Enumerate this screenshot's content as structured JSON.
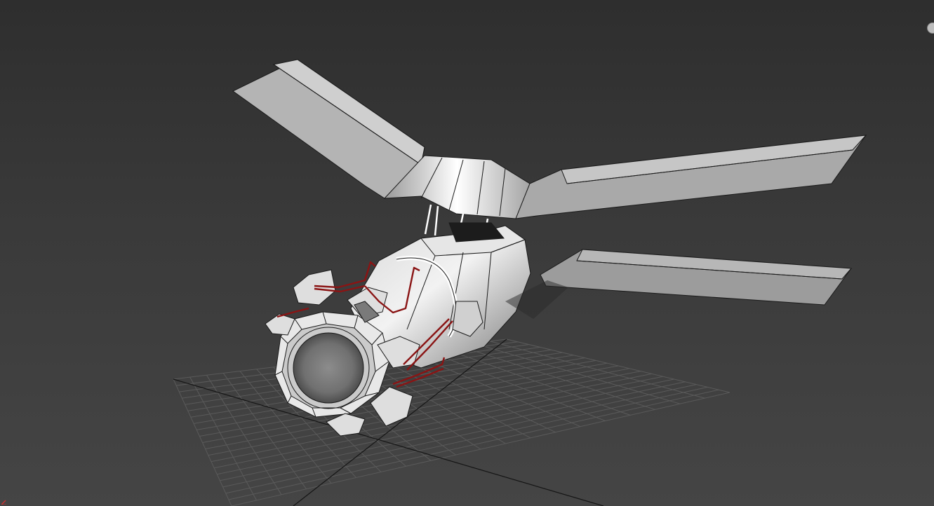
{
  "viewport": {
    "background_top": "#2e2e2e",
    "background_bottom": "#454545",
    "grid_color": "#5a5a5a",
    "grid_axis_color": "#141414"
  },
  "model": {
    "surface_light": "#f4f4f4",
    "surface_mid": "#b9b9b9",
    "surface_dark": "#6b6b6b",
    "edge_color": "#1a1a1a",
    "cable_color": "#8a1414"
  },
  "icons": {
    "viewcube": "orbit-icon",
    "axis": "axis-gizmo-icon"
  }
}
